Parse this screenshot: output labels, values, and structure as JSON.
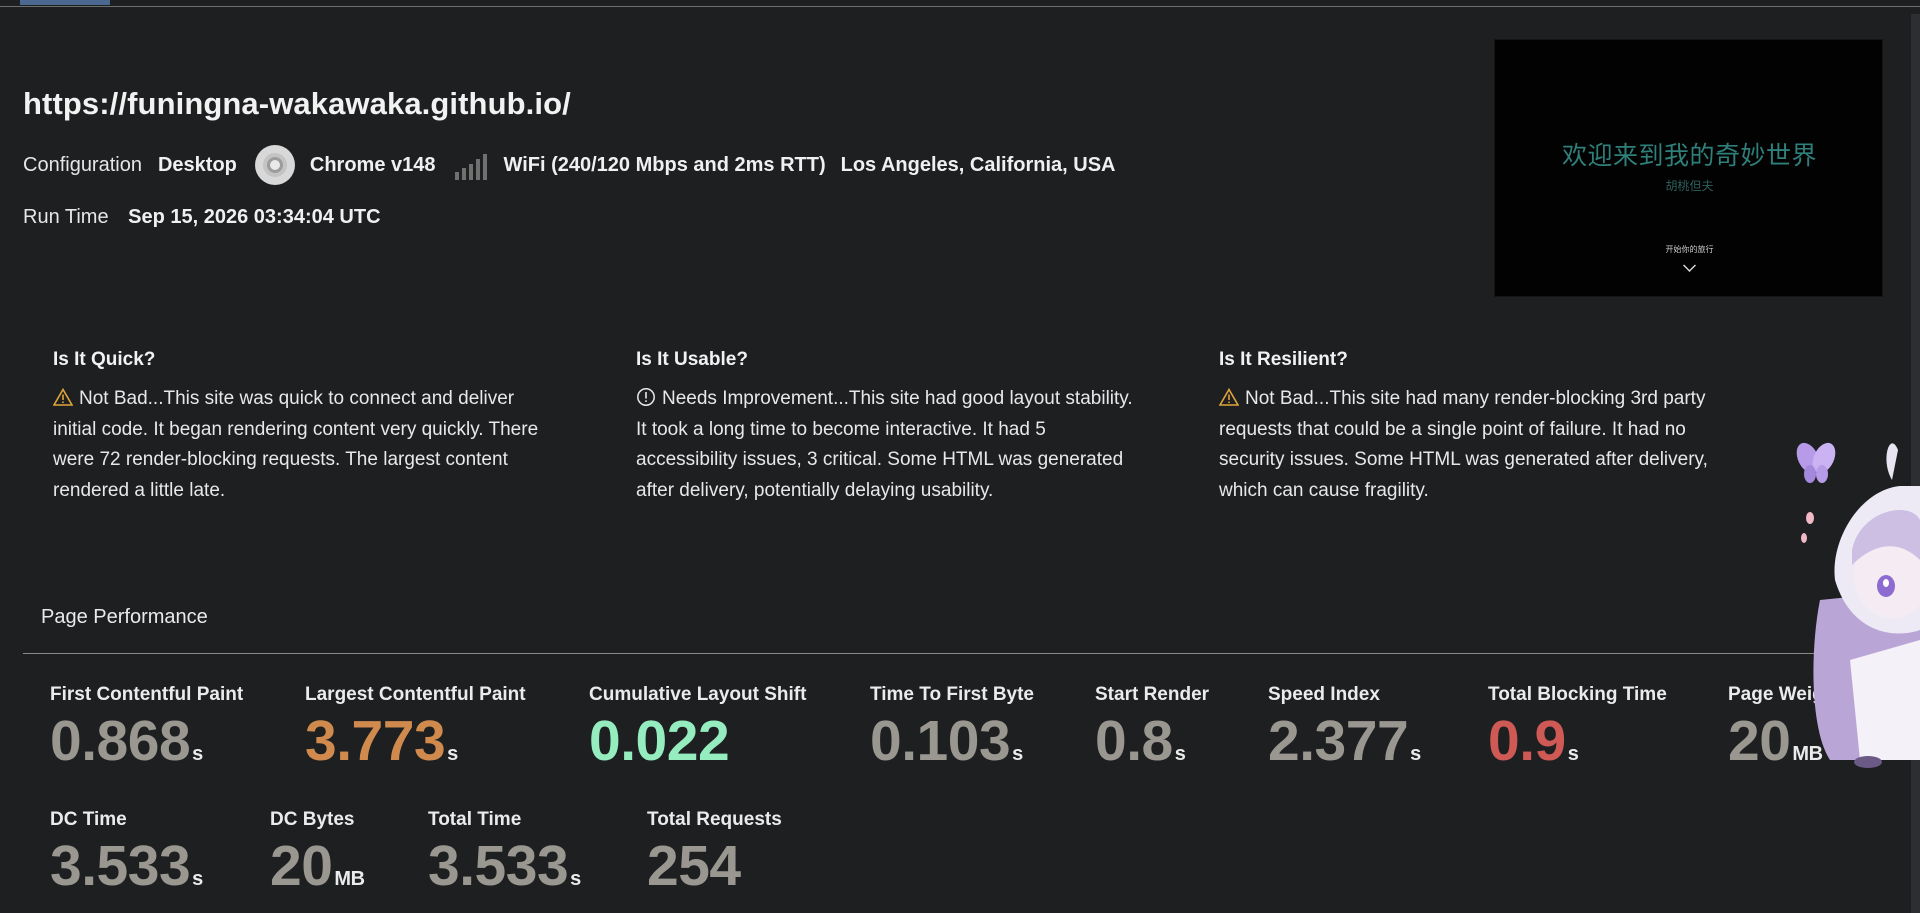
{
  "header": {
    "url": "https://funingna-wakawaka.github.io/",
    "config_label": "Configuration",
    "device": "Desktop",
    "browser": "Chrome v148",
    "connection": "WiFi (240/120 Mbps and 2ms RTT)",
    "location": "Los Angeles, California, USA",
    "run_time_label": "Run Time",
    "run_time": "Sep 15, 2026 03:34:04 UTC"
  },
  "thumbnail": {
    "title": "欢迎来到我的奇妙世界",
    "subtitle": "胡桃但夫",
    "cta": "开始你的旅行"
  },
  "summary": [
    {
      "title": "Is It Quick?",
      "status_icon": "warning-icon",
      "text": "Not Bad...This site was quick to connect and deliver initial code. It began rendering content very quickly. There were 72 render-blocking requests. The largest content rendered a little late."
    },
    {
      "title": "Is It Usable?",
      "status_icon": "info-icon",
      "text": "Needs Improvement...This site had good layout stability. It took a long time to become interactive. It had 5 accessibility issues, 3 critical. Some HTML was generated after delivery, potentially delaying usability."
    },
    {
      "title": "Is It Resilient?",
      "status_icon": "warning-icon",
      "text": "Not Bad...This site had many render-blocking 3rd party requests that could be a single point of failure. It had no security issues. Some HTML was generated after delivery, which can cause fragility."
    }
  ],
  "performance": {
    "title": "Page Performance",
    "metrics": [
      {
        "label": "First Contentful Paint",
        "value": "0.868",
        "unit": "s"
      },
      {
        "label": "Largest Contentful Paint",
        "value": "3.773",
        "unit": "s"
      },
      {
        "label": "Cumulative Layout Shift",
        "value": "0.022",
        "unit": ""
      },
      {
        "label": "Time To First Byte",
        "value": "0.103",
        "unit": "s"
      },
      {
        "label": "Start Render",
        "value": "0.8",
        "unit": "s"
      },
      {
        "label": "Speed Index",
        "value": "2.377",
        "unit": "s"
      },
      {
        "label": "Total Blocking Time",
        "value": "0.9",
        "unit": "s"
      },
      {
        "label": "Page Weig",
        "value": "20",
        "unit": "MB"
      },
      {
        "label": "DC Time",
        "value": "3.533",
        "unit": "s"
      },
      {
        "label": "DC Bytes",
        "value": "20",
        "unit": "MB"
      },
      {
        "label": "Total Time",
        "value": "3.533",
        "unit": "s"
      },
      {
        "label": "Total Requests",
        "value": "254",
        "unit": ""
      }
    ]
  },
  "colors": {
    "background": "#1d1f21",
    "neutral_value": "#9a9791",
    "good": "#94ecbf",
    "needs_improvement": "#d08a4d",
    "poor": "#cf5a55"
  }
}
